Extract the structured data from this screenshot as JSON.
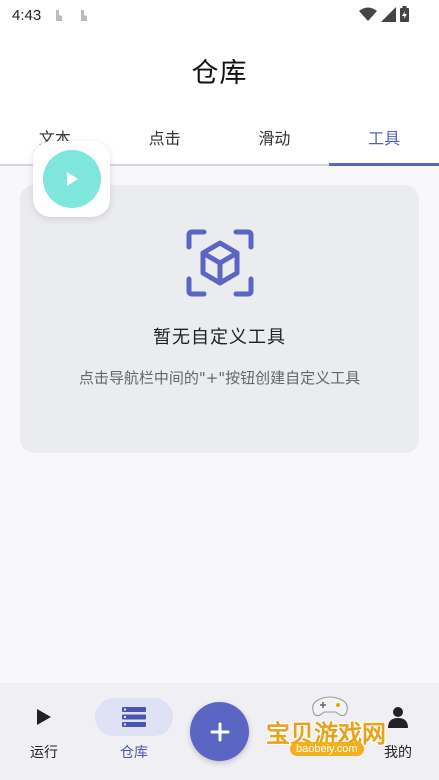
{
  "status_bar": {
    "time": "4:43"
  },
  "header": {
    "title": "仓库"
  },
  "tabs": [
    {
      "label": "文本",
      "active": false
    },
    {
      "label": "点击",
      "active": false
    },
    {
      "label": "滑动",
      "active": false
    },
    {
      "label": "工具",
      "active": true
    }
  ],
  "empty_state": {
    "icon": "cube-scan-icon",
    "title": "暂无自定义工具",
    "subtitle": "点击导航栏中间的\"+\"按钮创建自定义工具"
  },
  "bottom_nav": {
    "items": [
      {
        "label": "运行",
        "icon": "play-icon",
        "active": false
      },
      {
        "label": "仓库",
        "icon": "list-icon",
        "active": true
      },
      {
        "label": "我的",
        "icon": "person-icon",
        "active": false
      }
    ],
    "fab_icon": "plus-icon"
  },
  "watermark": {
    "text": "宝贝游戏网",
    "url": "baobeiy.com"
  },
  "colors": {
    "accent": "#5b66c4",
    "bubble": "#7ee6dd",
    "card": "#eaecf0"
  }
}
